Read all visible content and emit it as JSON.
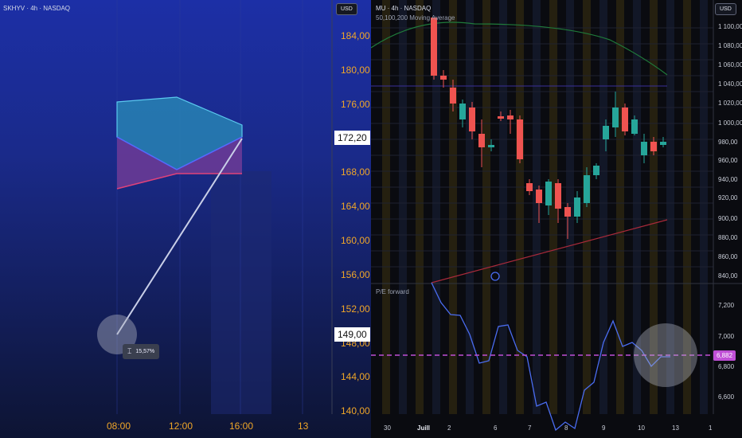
{
  "left_chart": {
    "symbol_label": "SKHYV · 4h · NASDAQ",
    "currency_button": "USD",
    "price_ticks": [
      "184,00",
      "180,00",
      "176,00",
      "172,20",
      "168,00",
      "164,00",
      "160,00",
      "156,00",
      "152,00",
      "149,00",
      "148,00",
      "144,00",
      "140,00"
    ],
    "current_price_tag": "172,20",
    "lower_price_tag": "149,00",
    "time_ticks": [
      "08:00",
      "12:00",
      "16:00",
      "13"
    ],
    "measure_icon": "measure-cursor-icon",
    "measure_percent": "15,57%",
    "colors": {
      "accent_text": "#f0a628",
      "teal_fill": "#2a8fb8",
      "purple_fill": "#7a3e98",
      "line": "#c9cfe8"
    }
  },
  "right_chart": {
    "symbol_label": "MU · 4h · NASDAQ",
    "indicator_label": "50,100,200 Moving Average",
    "currency_button": "USD",
    "price_ticks": [
      "1 100,00",
      "1 080,00",
      "1 060,00",
      "1 040,00",
      "1 020,00",
      "1 000,00",
      "980,00",
      "960,00",
      "940,00",
      "920,00",
      "900,00",
      "880,00",
      "860,00",
      "840,00"
    ],
    "pe_label": "P/E forward",
    "pe_ticks": [
      "7,200",
      "7,000",
      "6,800",
      "6,600"
    ],
    "pe_tag": "6,882",
    "date_ticks": [
      "30",
      "Juill",
      "2",
      "6",
      "7",
      "8",
      "9",
      "10",
      "13",
      "1"
    ],
    "colors": {
      "up": "#26a69a",
      "down": "#ef5350",
      "pe_line": "#4a6cf0",
      "pe_dash": "#c04fd6"
    }
  }
}
